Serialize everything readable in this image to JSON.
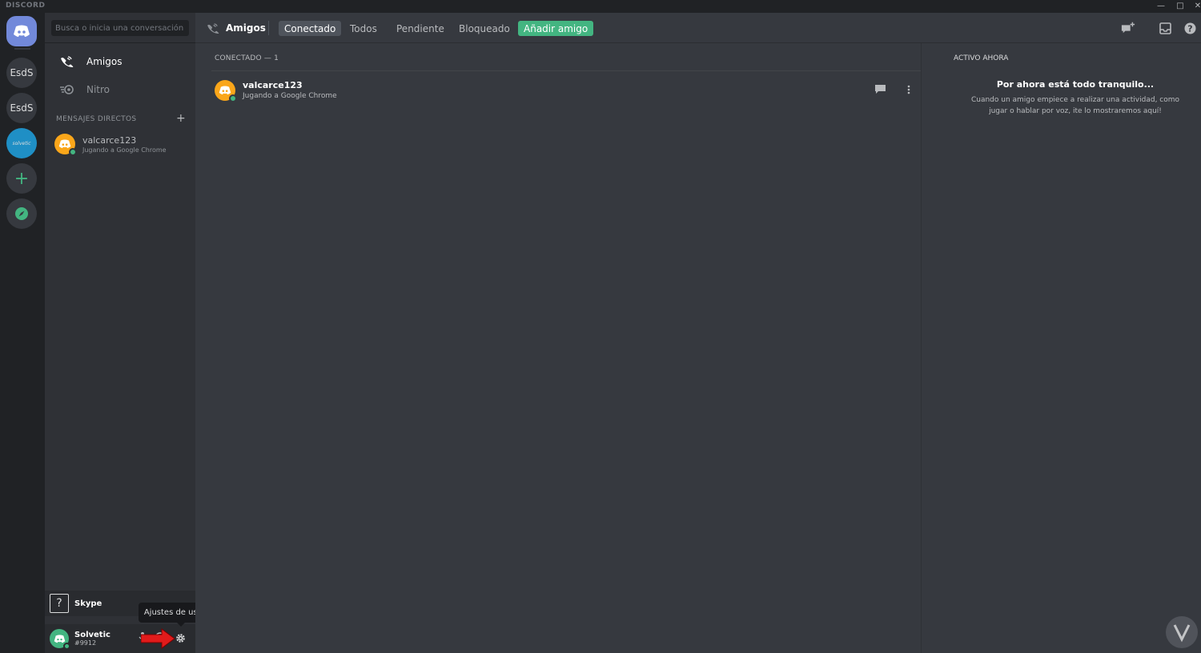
{
  "app": {
    "brand": "DISCORD"
  },
  "servers": [
    {
      "label": "EsdS"
    },
    {
      "label": "EsdS"
    },
    {
      "label": "solvetic"
    }
  ],
  "sidebar": {
    "search_placeholder": "Busca o inicia una conversación",
    "nav": [
      {
        "label": "Amigos",
        "icon": "friends-wave-icon"
      },
      {
        "label": "Nitro",
        "icon": "nitro-icon"
      }
    ],
    "dm_header": "MENSAJES DIRECTOS",
    "dm_add": "+",
    "dms": [
      {
        "name": "valcarce123",
        "status": "Jugando a Google Chrome"
      }
    ],
    "activity": {
      "icon_text": "?",
      "name": "Skype"
    },
    "user": {
      "name": "Solvetic",
      "tag": "#9912"
    },
    "tooltip": "Ajustes de usuario"
  },
  "topbar": {
    "title": "Amigos",
    "tabs": [
      {
        "label": "Conectado",
        "state": "active"
      },
      {
        "label": "Todos",
        "state": "normal"
      },
      {
        "label": "Pendiente",
        "state": "normal"
      },
      {
        "label": "Bloqueado",
        "state": "normal"
      },
      {
        "label": "Añadir amigo",
        "state": "add"
      }
    ]
  },
  "friends": {
    "section_header": "CONECTADO — 1",
    "list": [
      {
        "name": "valcarce123",
        "status": "Jugando a Google Chrome"
      }
    ]
  },
  "active_now": {
    "header": "ACTIVO AHORA",
    "title": "Por ahora está todo tranquilo...",
    "body": "Cuando un amigo empiece a realizar una actividad, como jugar o hablar por voz, ite lo mostraremos aquí!"
  },
  "colors": {
    "blurple": "#7289da",
    "green": "#43b581",
    "yellow": "#faa61a",
    "bg_main": "#36393f",
    "bg_sidebar": "#2f3136",
    "bg_rail": "#202225"
  }
}
